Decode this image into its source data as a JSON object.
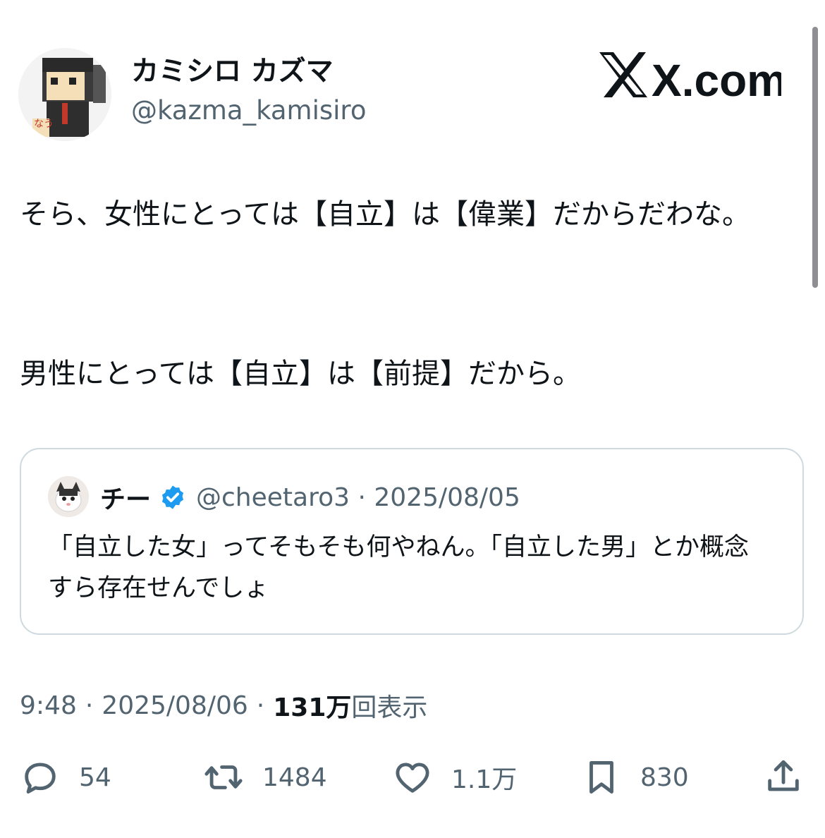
{
  "author": {
    "name": "カミシロ カズマ",
    "handle": "@kazma_kamisiro",
    "avatar_icon": "cardboard-figure-avatar"
  },
  "brand": {
    "logo_text": "X.com"
  },
  "tweet": {
    "paragraphs": [
      "そら、女性にとっては【自立】は【偉業】だからだわな。",
      "男性にとっては【自立】は【前提】だから。"
    ]
  },
  "quote": {
    "name": "チー",
    "verified": true,
    "handle_date": "@cheetaro3 · 2025/08/05",
    "text": "「自立した女」ってそもそも何やねん。「自立した男」とか概念すら存在せんでしょ"
  },
  "meta": {
    "time": "9:48",
    "date": "2025/08/06",
    "views_count": "131万",
    "views_label": "回表示",
    "separator": "·"
  },
  "actions": {
    "replies": "54",
    "retweets": "1484",
    "likes": "1.1万",
    "bookmarks": "830"
  },
  "colors": {
    "text": "#0f1419",
    "secondary": "#536471",
    "border": "#cfd9de",
    "verified": "#1d9bf0"
  }
}
